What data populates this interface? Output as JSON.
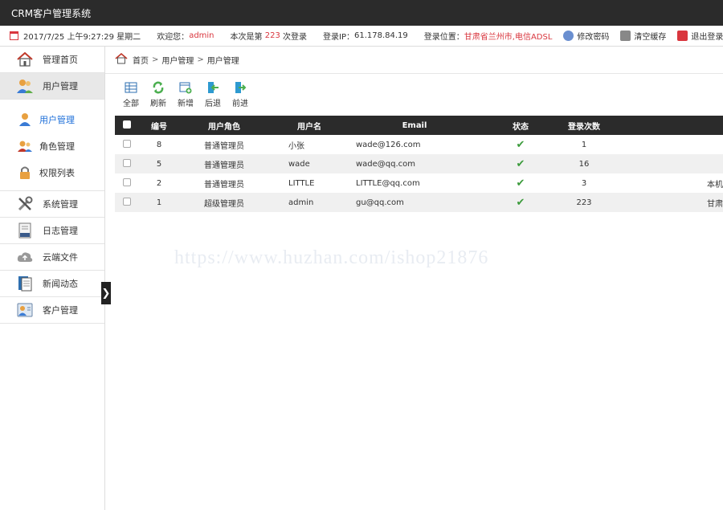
{
  "app": {
    "title": "CRM客户管理系统"
  },
  "infobar": {
    "datetime": "2017/7/25 上午9:27:29 星期二",
    "welcome_label": "欢迎您：",
    "username": "admin",
    "login_count_prefix": "本次是第",
    "login_count": "223",
    "login_count_suffix": "次登录",
    "ip_label": "登录IP：",
    "ip": "61.178.84.19",
    "location_label": "登录位置：",
    "location": "甘肃省兰州市,电信ADSL",
    "change_password": "修改密码",
    "clear_cache": "清空缓存",
    "logout": "退出登录"
  },
  "sidebar": {
    "items": [
      {
        "label": "管理首页",
        "icon": "home-icon"
      },
      {
        "label": "用户管理",
        "icon": "users-icon"
      },
      {
        "label": "系统管理",
        "icon": "tools-icon"
      },
      {
        "label": "日志管理",
        "icon": "log-icon"
      },
      {
        "label": "云端文件",
        "icon": "cloud-icon"
      },
      {
        "label": "新闻动态",
        "icon": "news-icon"
      },
      {
        "label": "客户管理",
        "icon": "customer-icon"
      }
    ],
    "subitems": [
      {
        "label": "用户管理",
        "icon": "user-icon"
      },
      {
        "label": "角色管理",
        "icon": "role-icon"
      },
      {
        "label": "权限列表",
        "icon": "lock-icon"
      }
    ],
    "toggle": "❯"
  },
  "breadcrumb": {
    "home": "首页",
    "level1": "用户管理",
    "level2": "用户管理",
    "separator": ">"
  },
  "toolbar": {
    "all": "全部",
    "refresh": "刷新",
    "add": "新增",
    "back": "后退",
    "forward": "前进"
  },
  "table": {
    "headers": {
      "id": "编号",
      "role": "用户角色",
      "username": "用户名",
      "email": "Email",
      "status": "状态",
      "logins": "登录次数"
    },
    "rows": [
      {
        "id": "8",
        "role": "普通管理员",
        "username": "小张",
        "email": "wade@126.com",
        "status": "✔",
        "logins": "1",
        "extra": ""
      },
      {
        "id": "5",
        "role": "普通管理员",
        "username": "wade",
        "email": "wade@qq.com",
        "status": "✔",
        "logins": "16",
        "extra": ""
      },
      {
        "id": "2",
        "role": "普通管理员",
        "username": "LITTLE",
        "email": "LITTLE@qq.com",
        "status": "✔",
        "logins": "3",
        "extra": "本机"
      },
      {
        "id": "1",
        "role": "超级管理员",
        "username": "admin",
        "email": "gu@qq.com",
        "status": "✔",
        "logins": "223",
        "extra": "甘肃"
      }
    ]
  },
  "watermark": "https://www.huzhan.com/ishop21876",
  "colors": {
    "topbar": "#2b2b2b",
    "accent_red": "#d9363e",
    "active_link": "#1e6fd9",
    "status_green": "#3a9a3a"
  }
}
